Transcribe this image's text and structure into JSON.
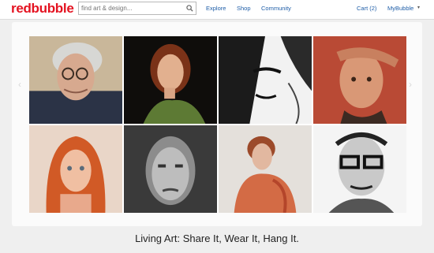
{
  "header": {
    "logo": "redbubble",
    "search": {
      "placeholder": "find art & design...",
      "icon": "search-icon"
    },
    "nav": {
      "explore": "Explore",
      "shop": "Shop",
      "community": "Community"
    },
    "cart": "Cart (2)",
    "account": "MyBubble",
    "account_caret": "▾"
  },
  "gallery": {
    "prev_arrow": "‹",
    "next_arrow": "›",
    "tiles": [
      {
        "name": "portrait-elderly-man-glasses"
      },
      {
        "name": "portrait-woman-green-dress"
      },
      {
        "name": "portrait-graphic-face"
      },
      {
        "name": "portrait-man-hand-head"
      },
      {
        "name": "portrait-red-hair-woman"
      },
      {
        "name": "portrait-bald-man-pencil"
      },
      {
        "name": "portrait-woman-watercolor"
      },
      {
        "name": "portrait-man-ink-glasses"
      }
    ]
  },
  "tagline": "Living Art: Share It, Wear It, Hang It.",
  "colors": {
    "brand": "#e41321",
    "link": "#1f5ea8"
  }
}
